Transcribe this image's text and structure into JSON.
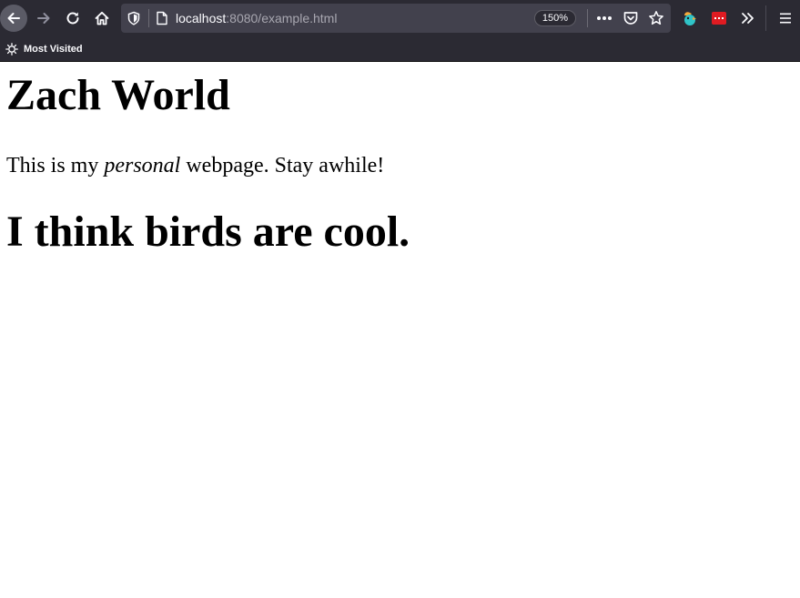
{
  "browser": {
    "url_host": "localhost",
    "url_rest": ":8080/example.html",
    "zoom": "150%",
    "bookmarks_toolbar": {
      "items": [
        {
          "label": "Most Visited"
        }
      ]
    },
    "icons": {
      "back": "back-arrow-icon",
      "forward": "forward-arrow-icon",
      "reload": "reload-icon",
      "home": "home-icon",
      "tracking": "shield-icon",
      "page": "page-icon",
      "more": "more-icon",
      "pocket": "pocket-icon",
      "bookmark": "star-icon",
      "extension_1": "bird-extension-icon",
      "extension_2": "red-extension-icon",
      "overflow": "chevron-double-right-icon",
      "menu": "hamburger-menu-icon",
      "bookmark_folder": "gear-icon"
    },
    "colors": {
      "chrome_bg": "#2b2a33",
      "urlbar_bg": "#42414d",
      "text": "#fbfbfe",
      "muted_text": "#a8a7b0"
    }
  },
  "page": {
    "heading": "Zach World",
    "intro": {
      "before": "This is my ",
      "emphasis": "personal",
      "after": " webpage. Stay awhile!"
    },
    "subheading": "I think birds are cool."
  }
}
